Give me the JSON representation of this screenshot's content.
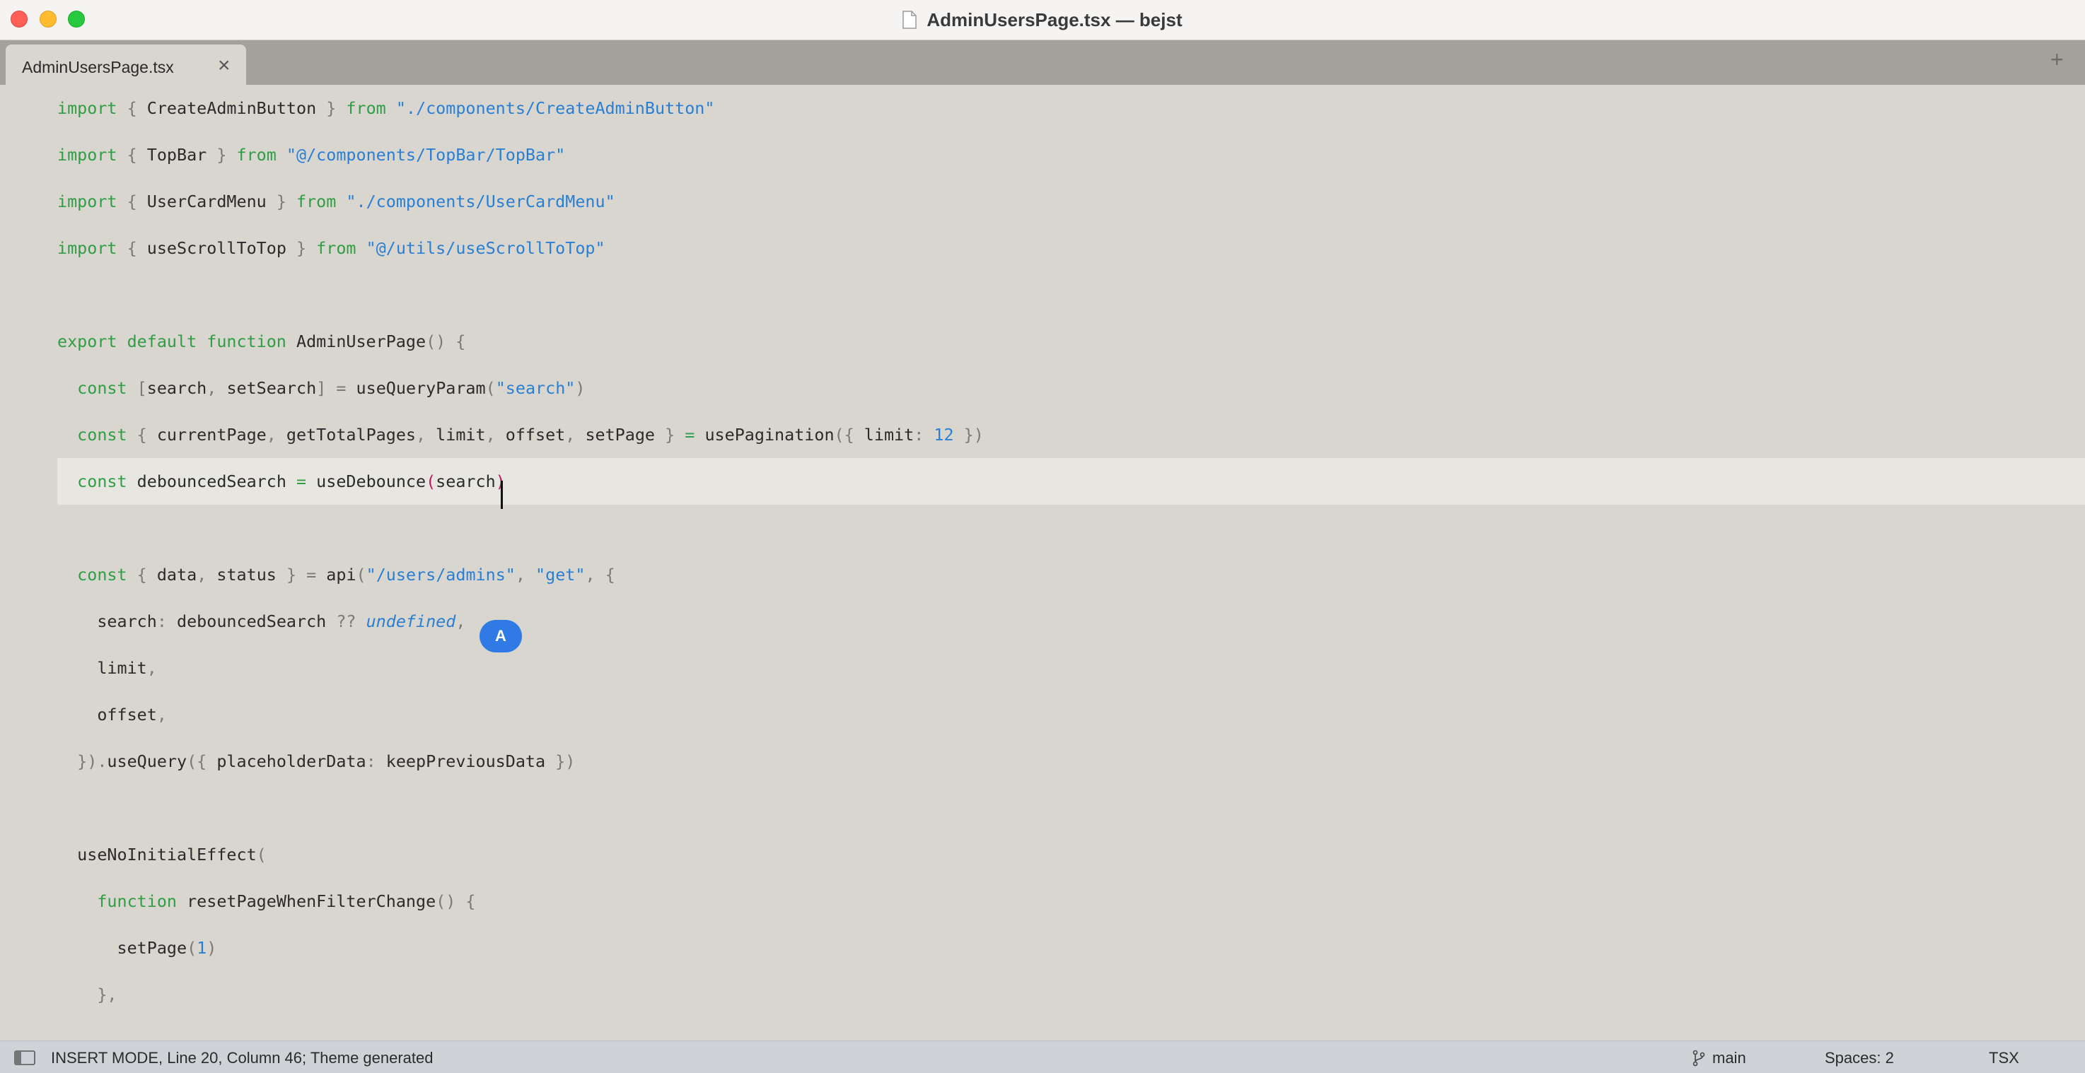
{
  "window": {
    "title": "AdminUsersPage.tsx — bejst",
    "traffic_lights": {
      "close": "#fe5f57",
      "minimize": "#febc2e",
      "maximize": "#28c840"
    }
  },
  "tabs": [
    {
      "label": "AdminUsersPage.tsx",
      "close_glyph": "×",
      "active": true
    }
  ],
  "tabbar": {
    "new_tab_glyph": "+"
  },
  "editor": {
    "current_line_index": 8,
    "mode_indicator": "A",
    "colors": {
      "keyword": "#2f9e44",
      "string": "#2a7fd4",
      "punctuation": "#7c7a74",
      "identifier": "#2b2b2b",
      "bracket_highlight": "#c2185b",
      "background": "#d8d6cf",
      "current_line": "#e8e6e0"
    },
    "lines": [
      [
        [
          "k",
          "import "
        ],
        [
          "p",
          "{ "
        ],
        [
          "i",
          "CreateAdminButton "
        ],
        [
          "p",
          "} "
        ],
        [
          "k",
          "from "
        ],
        [
          "s",
          "\"./components/CreateAdminButton\""
        ]
      ],
      [
        [
          "k",
          "import "
        ],
        [
          "p",
          "{ "
        ],
        [
          "i",
          "TopBar "
        ],
        [
          "p",
          "} "
        ],
        [
          "k",
          "from "
        ],
        [
          "s",
          "\"@/components/TopBar/TopBar\""
        ]
      ],
      [
        [
          "k",
          "import "
        ],
        [
          "p",
          "{ "
        ],
        [
          "i",
          "UserCardMenu "
        ],
        [
          "p",
          "} "
        ],
        [
          "k",
          "from "
        ],
        [
          "s",
          "\"./components/UserCardMenu\""
        ]
      ],
      [
        [
          "k",
          "import "
        ],
        [
          "p",
          "{ "
        ],
        [
          "i",
          "useScrollToTop "
        ],
        [
          "p",
          "} "
        ],
        [
          "k",
          "from "
        ],
        [
          "s",
          "\"@/utils/useScrollToTop\""
        ]
      ],
      [],
      [
        [
          "k",
          "export default function "
        ],
        [
          "i",
          "AdminUserPage"
        ],
        [
          "p",
          "() {"
        ]
      ],
      [
        [
          "i",
          "  "
        ],
        [
          "k",
          "const "
        ],
        [
          "p",
          "["
        ],
        [
          "i",
          "search"
        ],
        [
          "p",
          ", "
        ],
        [
          "i",
          "setSearch"
        ],
        [
          "p",
          "] = "
        ],
        [
          "i",
          "useQueryParam"
        ],
        [
          "p",
          "("
        ],
        [
          "s",
          "\"search\""
        ],
        [
          "p",
          ")"
        ]
      ],
      [
        [
          "i",
          "  "
        ],
        [
          "k",
          "const "
        ],
        [
          "p",
          "{ "
        ],
        [
          "i",
          "currentPage"
        ],
        [
          "p",
          ", "
        ],
        [
          "i",
          "getTotalPages"
        ],
        [
          "p",
          ", "
        ],
        [
          "i",
          "limit"
        ],
        [
          "p",
          ", "
        ],
        [
          "i",
          "offset"
        ],
        [
          "p",
          ", "
        ],
        [
          "i",
          "setPage "
        ],
        [
          "p",
          "} "
        ],
        [
          "k",
          "= "
        ],
        [
          "i",
          "usePagination"
        ],
        [
          "p",
          "({ "
        ],
        [
          "i",
          "limit"
        ],
        [
          "p",
          ": "
        ],
        [
          "n",
          "12"
        ],
        [
          "p",
          " })"
        ]
      ],
      [
        [
          "i",
          "  "
        ],
        [
          "k",
          "const "
        ],
        [
          "i",
          "debouncedSearch "
        ],
        [
          "k",
          "= "
        ],
        [
          "i",
          "useDebounce"
        ],
        [
          "b",
          "("
        ],
        [
          "i",
          "search"
        ],
        [
          "b",
          ")"
        ]
      ],
      [],
      [
        [
          "i",
          "  "
        ],
        [
          "k",
          "const "
        ],
        [
          "p",
          "{ "
        ],
        [
          "i",
          "data"
        ],
        [
          "p",
          ", "
        ],
        [
          "i",
          "status "
        ],
        [
          "p",
          "} = "
        ],
        [
          "i",
          "api"
        ],
        [
          "p",
          "("
        ],
        [
          "s",
          "\"/users/admins\""
        ],
        [
          "p",
          ", "
        ],
        [
          "s",
          "\"get\""
        ],
        [
          "p",
          ", {"
        ]
      ],
      [
        [
          "i",
          "    search"
        ],
        [
          "p",
          ": "
        ],
        [
          "i",
          "debouncedSearch "
        ],
        [
          "p",
          "?? "
        ],
        [
          "t",
          "undefined"
        ],
        [
          "p",
          ","
        ]
      ],
      [
        [
          "i",
          "    limit"
        ],
        [
          "p",
          ","
        ]
      ],
      [
        [
          "i",
          "    offset"
        ],
        [
          "p",
          ","
        ]
      ],
      [
        [
          "p",
          "  })."
        ],
        [
          "i",
          "useQuery"
        ],
        [
          "p",
          "({ "
        ],
        [
          "i",
          "placeholderData"
        ],
        [
          "p",
          ": "
        ],
        [
          "i",
          "keepPreviousData "
        ],
        [
          "p",
          "})"
        ]
      ],
      [],
      [
        [
          "i",
          "  useNoInitialEffect"
        ],
        [
          "p",
          "("
        ]
      ],
      [
        [
          "i",
          "    "
        ],
        [
          "k",
          "function "
        ],
        [
          "i",
          "resetPageWhenFilterChange"
        ],
        [
          "p",
          "() {"
        ]
      ],
      [
        [
          "i",
          "      setPage"
        ],
        [
          "p",
          "("
        ],
        [
          "n",
          "1"
        ],
        [
          "p",
          ")"
        ]
      ],
      [
        [
          "p",
          "    },"
        ]
      ]
    ]
  },
  "statusbar": {
    "status": "INSERT MODE, Line 20, Column 46; Theme generated",
    "branch": "main",
    "indentation": "Spaces: 2",
    "syntax": "TSX"
  }
}
